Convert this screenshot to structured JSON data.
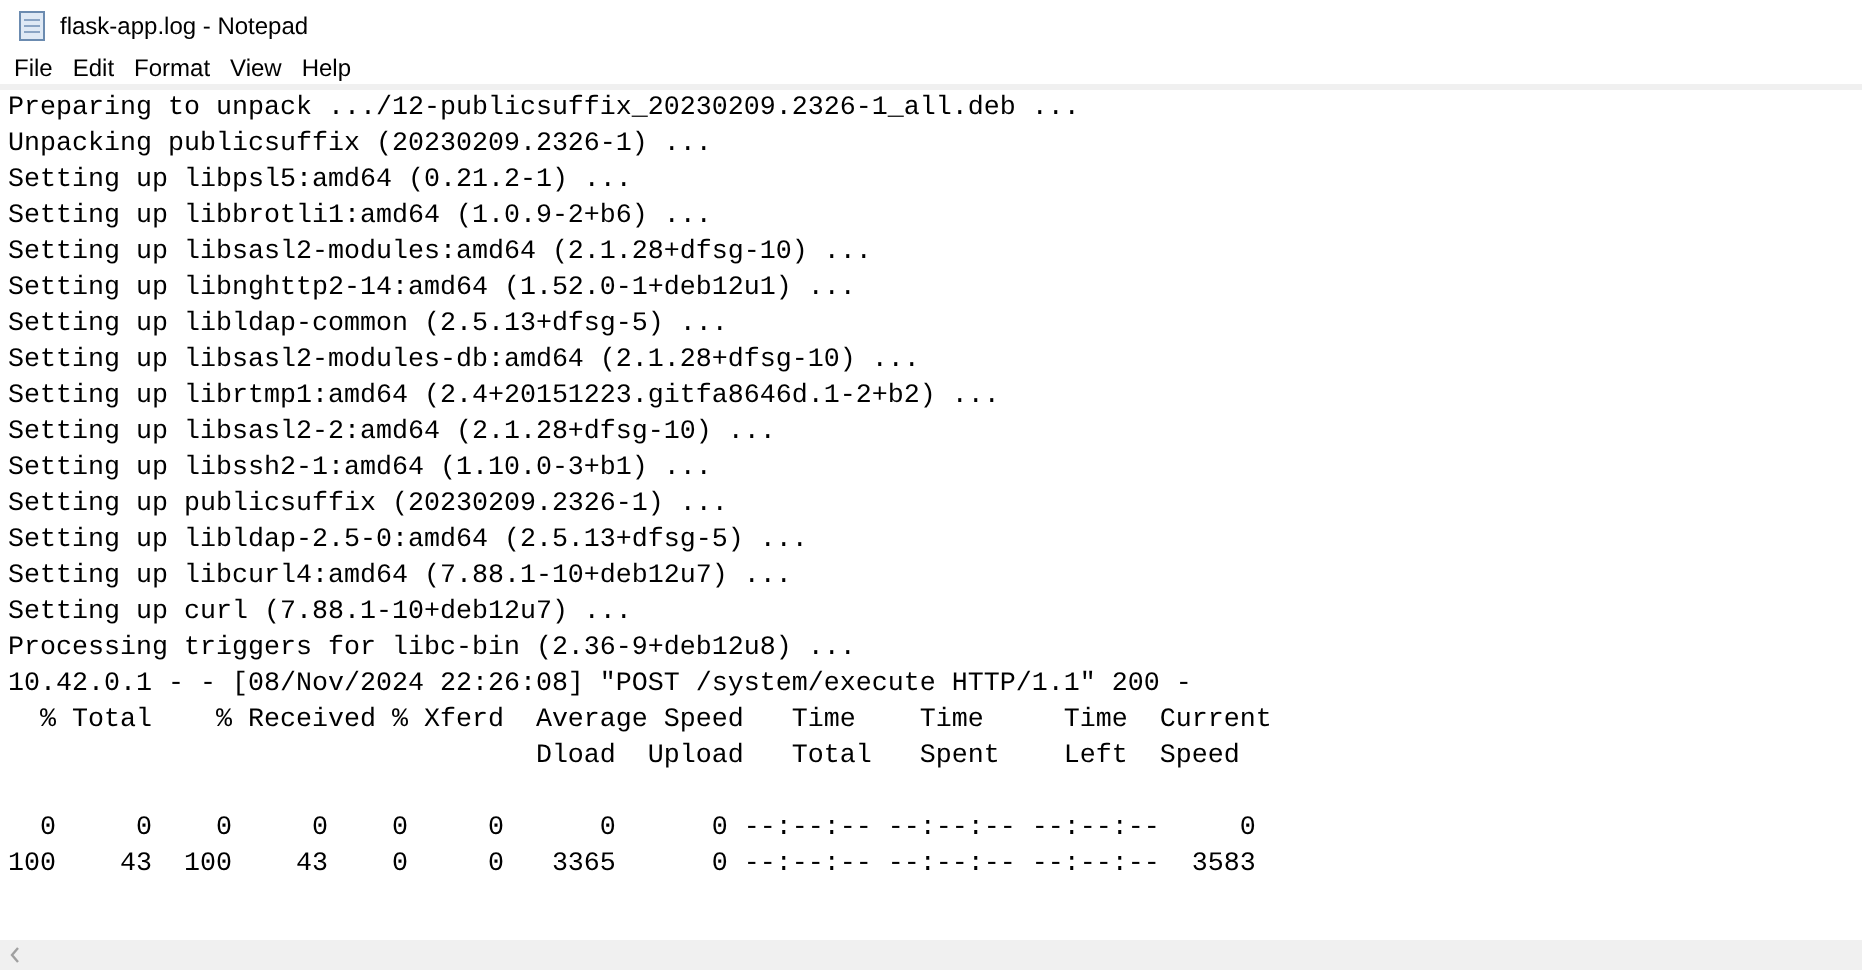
{
  "window": {
    "title": "flask-app.log - Notepad"
  },
  "menu": [
    "File",
    "Edit",
    "Format",
    "View",
    "Help"
  ],
  "lines": [
    {
      "kind": "text",
      "text": "Preparing to unpack .../12-publicsuffix_20230209.2326-1_all.deb ..."
    },
    {
      "kind": "text",
      "text": "Unpacking publicsuffix (20230209.2326-1) ..."
    },
    {
      "kind": "text",
      "text": "Setting up libpsl5:amd64 (0.21.2-1) ..."
    },
    {
      "kind": "text",
      "text": "Setting up libbrotli1:amd64 (1.0.9-2+b6) ..."
    },
    {
      "kind": "text",
      "text": "Setting up libsasl2-modules:amd64 (2.1.28+dfsg-10) ..."
    },
    {
      "kind": "text",
      "text": "Setting up libnghttp2-14:amd64 (1.52.0-1+deb12u1) ..."
    },
    {
      "kind": "text",
      "text": "Setting up libldap-common (2.5.13+dfsg-5) ..."
    },
    {
      "kind": "text",
      "text": "Setting up libsasl2-modules-db:amd64 (2.1.28+dfsg-10) ..."
    },
    {
      "kind": "text",
      "text": "Setting up librtmp1:amd64 (2.4+20151223.gitfa8646d.1-2+b2) ..."
    },
    {
      "kind": "text",
      "text": "Setting up libsasl2-2:amd64 (2.1.28+dfsg-10) ..."
    },
    {
      "kind": "text",
      "text": "Setting up libssh2-1:amd64 (1.10.0-3+b1) ..."
    },
    {
      "kind": "text",
      "text": "Setting up publicsuffix (20230209.2326-1) ..."
    },
    {
      "kind": "text",
      "text": "Setting up libldap-2.5-0:amd64 (2.5.13+dfsg-5) ..."
    },
    {
      "kind": "text",
      "text": "Setting up libcurl4:amd64 (7.88.1-10+deb12u7) ..."
    },
    {
      "kind": "text",
      "text": "Setting up curl (7.88.1-10+deb12u7) ..."
    },
    {
      "kind": "text",
      "text": "Processing triggers for libc-bin (2.36-9+deb12u8) ..."
    },
    {
      "kind": "text",
      "text": "10.42.0.1 - - [08/Nov/2024 22:26:08] \"POST /system/execute HTTP/1.1\" 200 -"
    },
    {
      "kind": "text",
      "text": "  % Total    % Received % Xferd  Average Speed   Time    Time     Time  Current"
    },
    {
      "kind": "text",
      "text": "                                 Dload  Upload   Total   Spent    Left  Speed"
    },
    {
      "kind": "blank"
    },
    {
      "kind": "text",
      "text": "  0     0    0     0    0     0      0      0 --:--:-- --:--:-- --:--:--     0"
    },
    {
      "kind": "text",
      "text": "100    43  100    43    0     0   3365      0 --:--:-- --:--:-- --:--:--  3583"
    }
  ]
}
